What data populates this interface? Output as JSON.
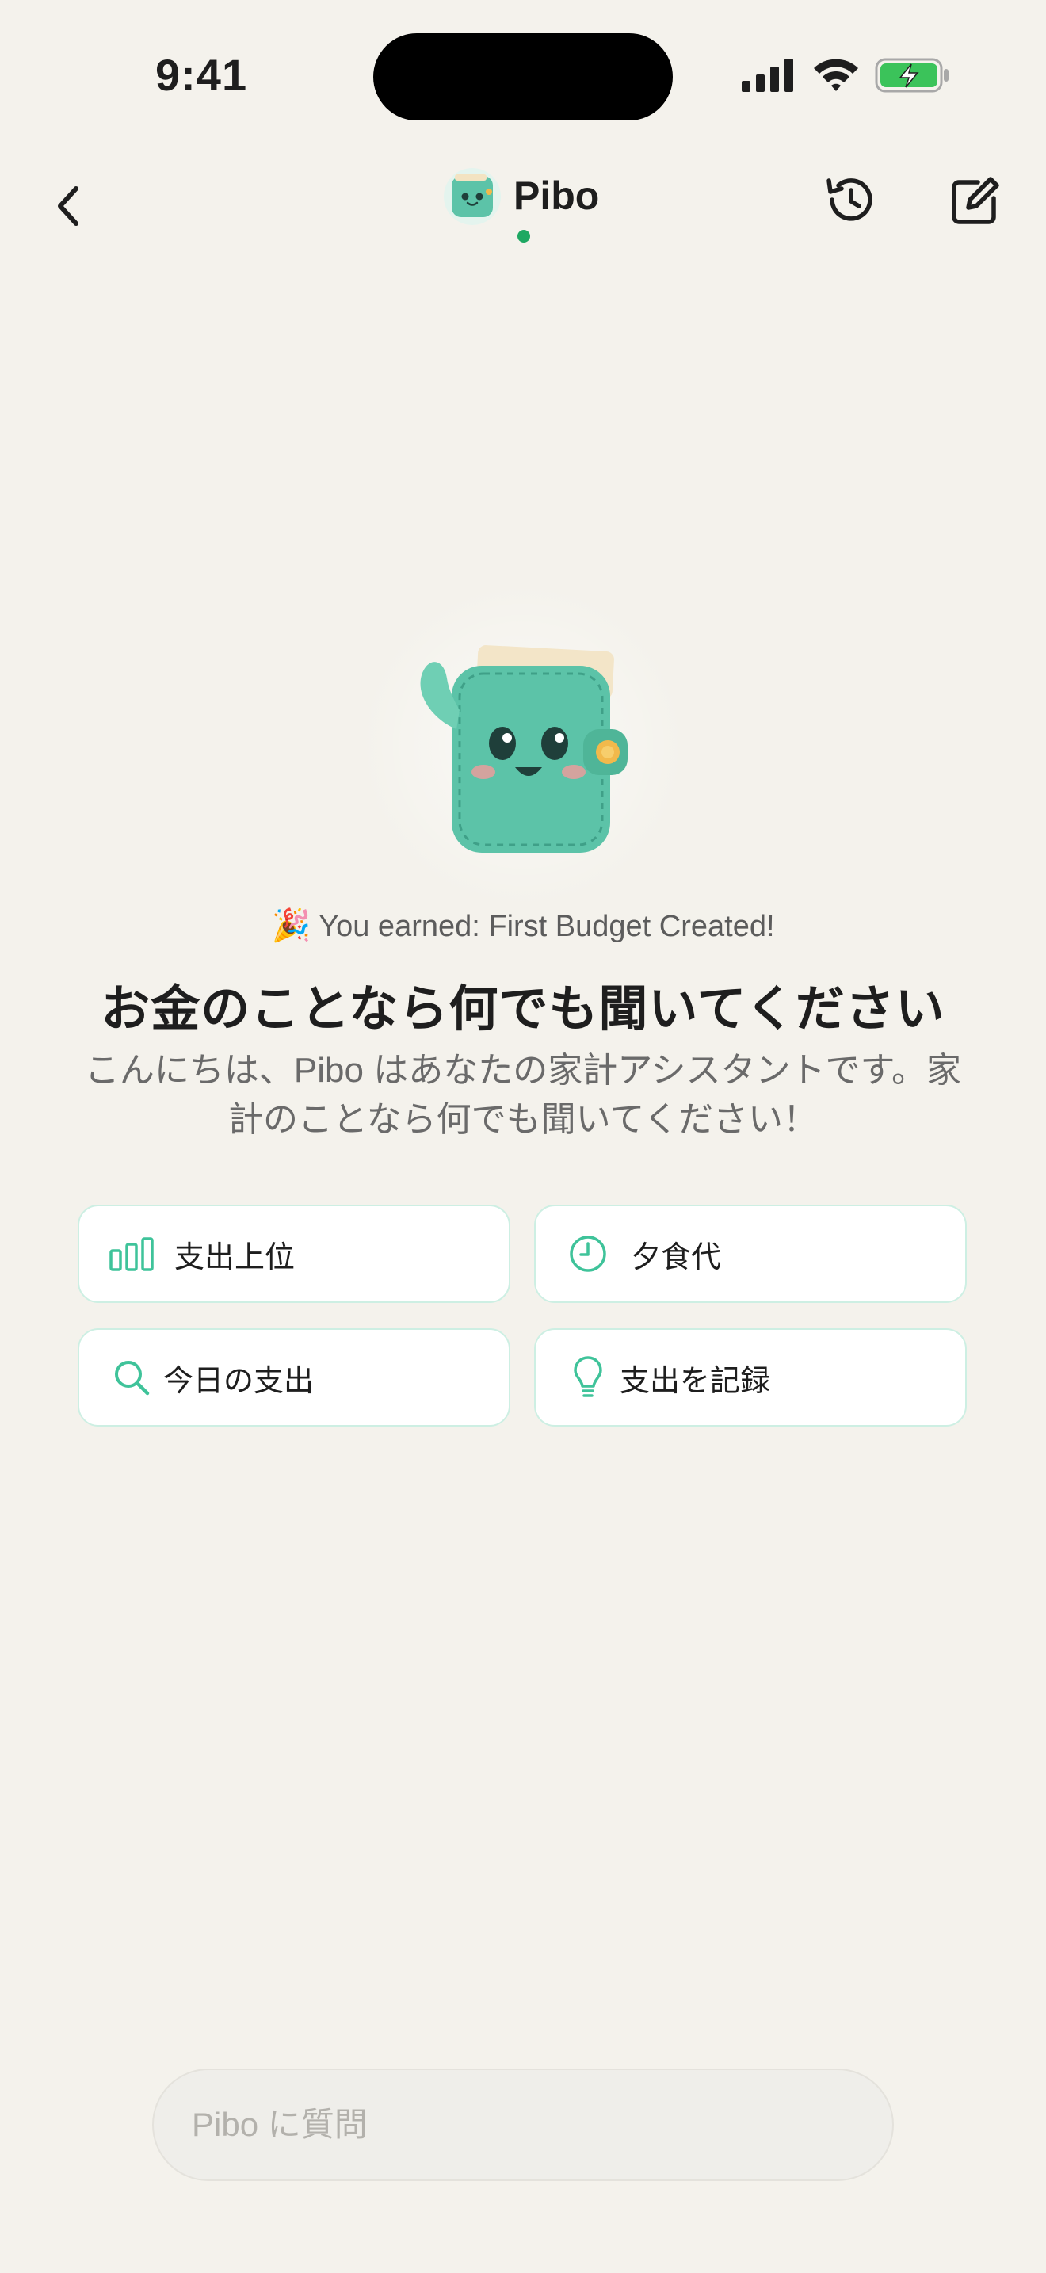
{
  "status_bar": {
    "time": "9:41"
  },
  "nav": {
    "title": "Pibo",
    "icons": {
      "back": "chevron-left-icon",
      "history": "history-icon",
      "compose": "compose-icon"
    }
  },
  "achievement": {
    "emoji": "🎉",
    "text": "You earned: First Budget Created!"
  },
  "headline": "お金のことなら何でも聞いてください",
  "subtitle": "こんにちは、Pibo はあなたの家計アシスタントです。家計のことなら何でも聞いてください！",
  "suggestions": [
    {
      "label": "支出上位",
      "icon": "bar-chart-icon"
    },
    {
      "label": "夕食代",
      "icon": "clock-icon"
    },
    {
      "label": "今日の支出",
      "icon": "search-icon"
    },
    {
      "label": "支出を記録",
      "icon": "lightbulb-icon"
    }
  ],
  "input": {
    "placeholder": "Pibo に質問",
    "value": ""
  },
  "colors": {
    "background": "#F4F2EC",
    "accent": "#3FC39A",
    "online": "#1EA862",
    "mascot": "#5CC3A8"
  }
}
